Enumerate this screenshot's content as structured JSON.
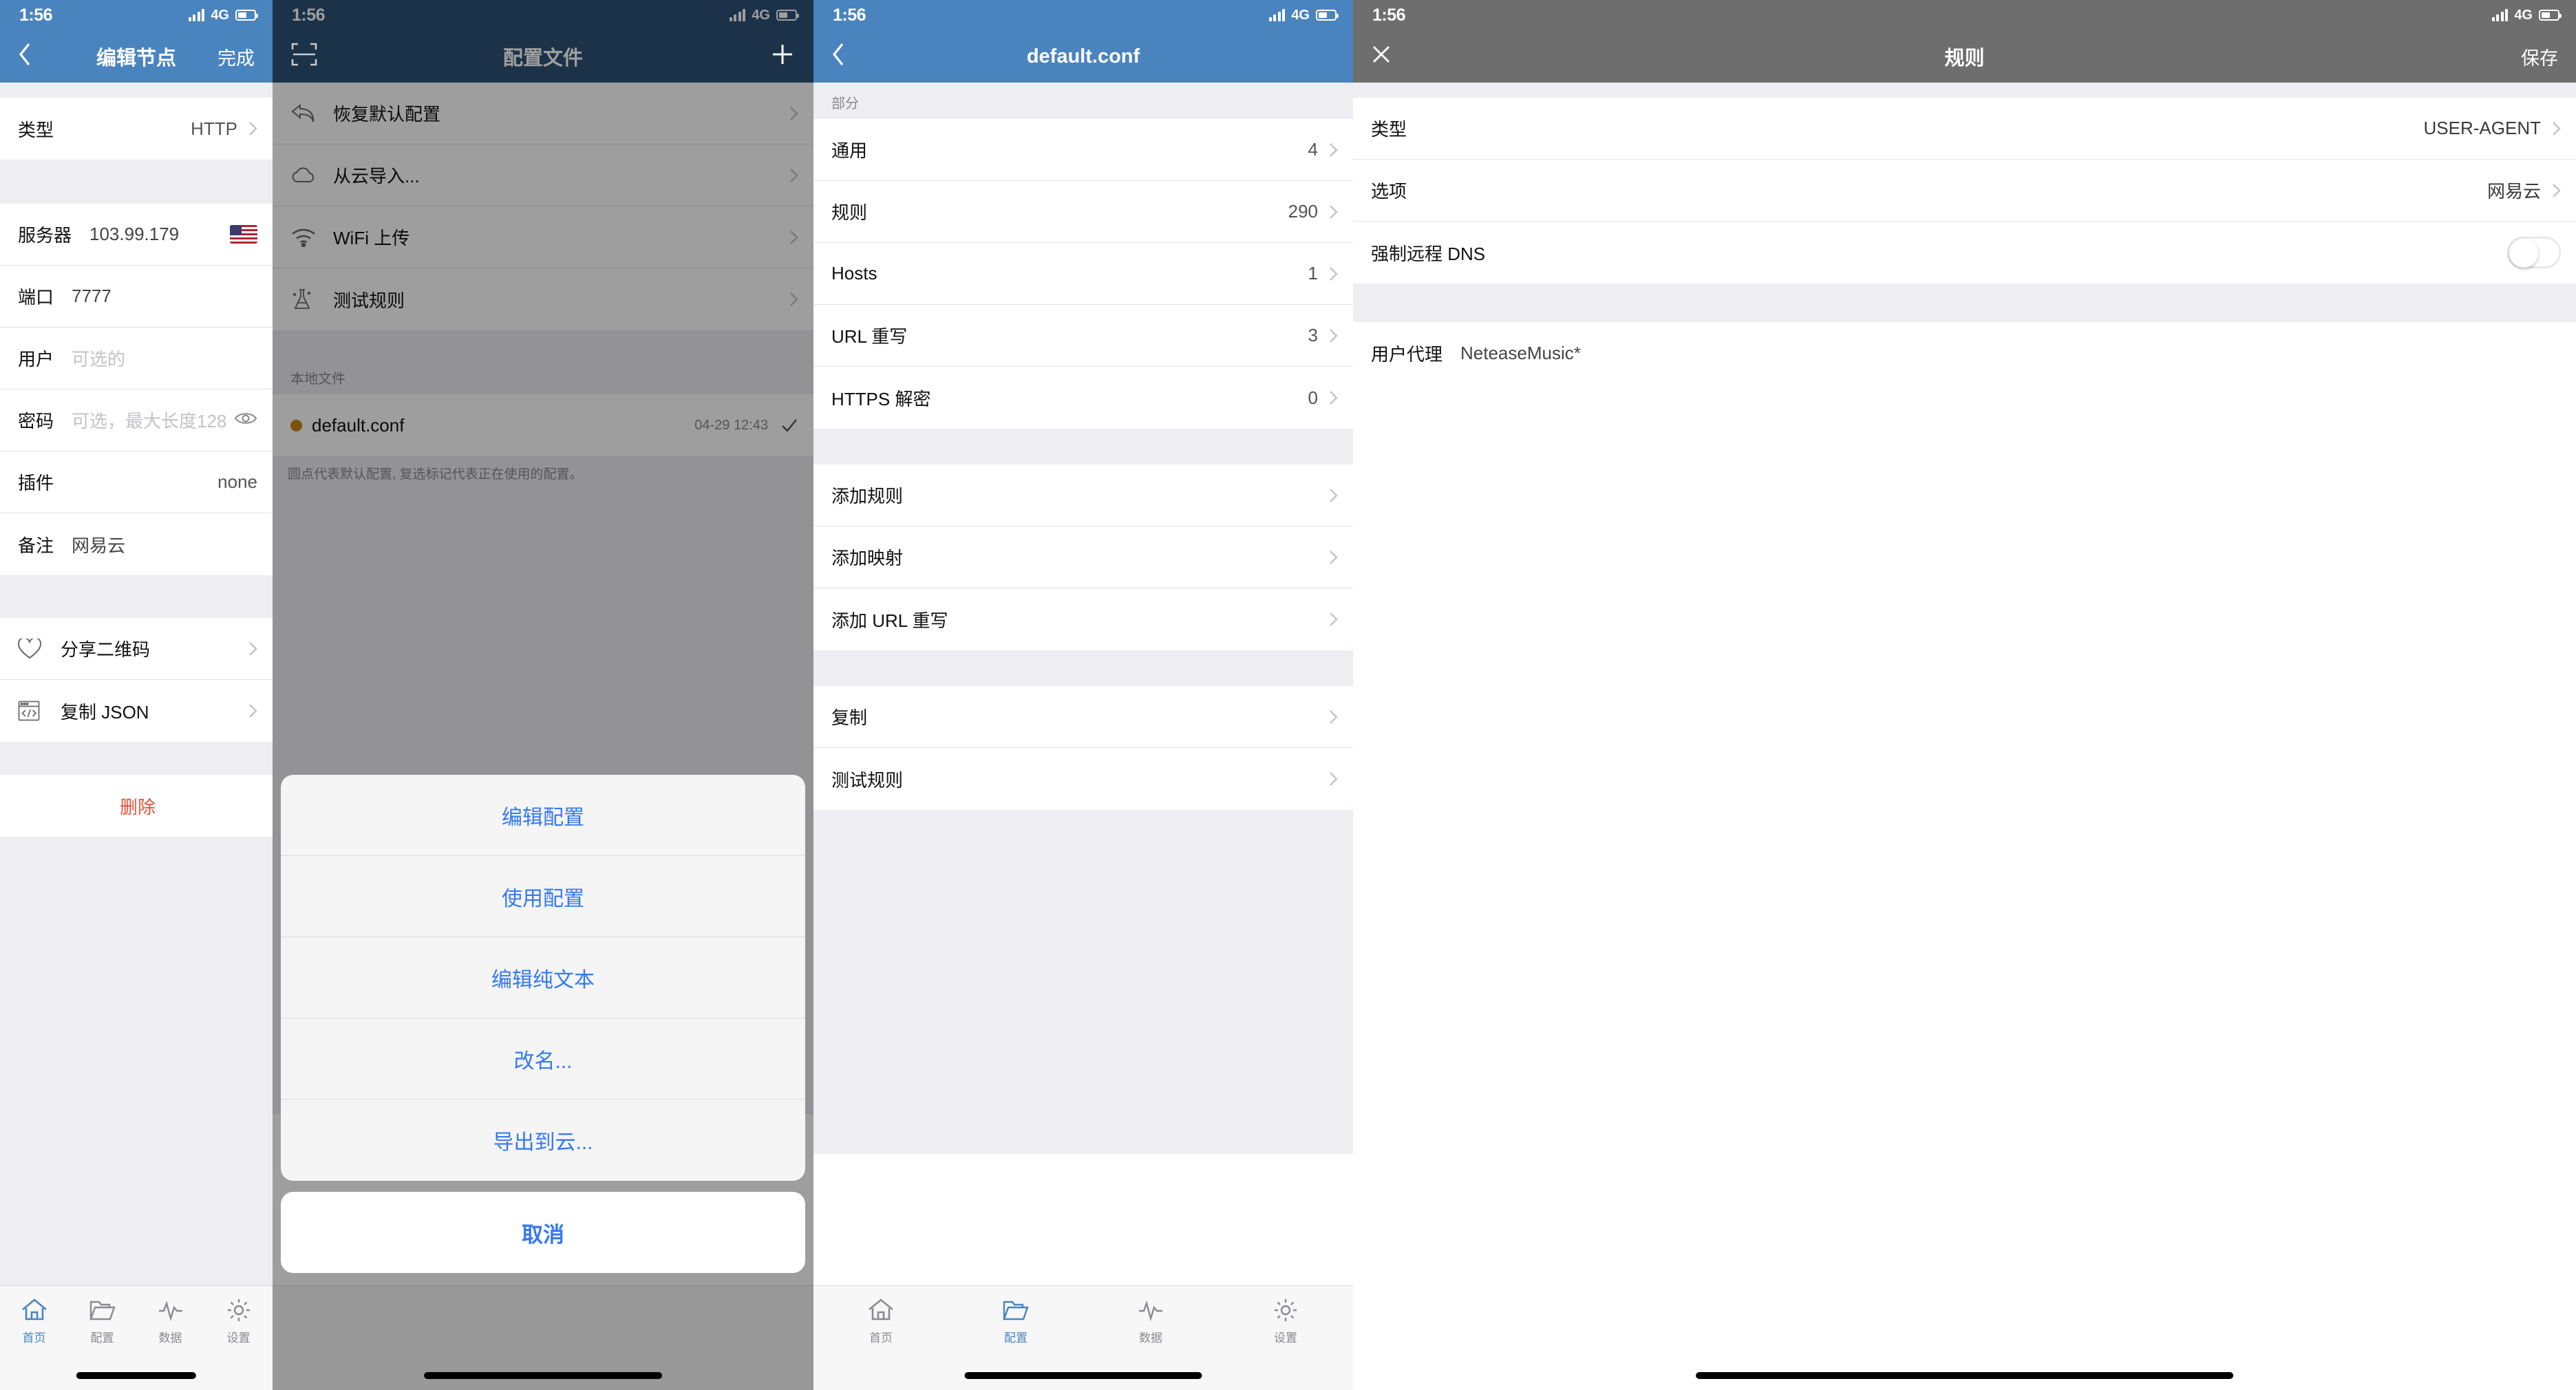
{
  "statusbar": {
    "time": "1:56",
    "network": "4G"
  },
  "colors": {
    "nav_blue": "#4a84bf",
    "nav_navy": "#2e5277",
    "nav_gray": "#6e6e6e",
    "accent_blue": "#3478f6",
    "destructive": "#e8503a",
    "default_dot": "#c8860d"
  },
  "panel1": {
    "nav": {
      "back_icon": "chevron-left-icon",
      "title": "编辑节点",
      "right_label": "完成"
    },
    "rows": [
      {
        "label": "类型",
        "value": "HTTP",
        "chevron": true
      }
    ],
    "server_group": [
      {
        "label": "服务器",
        "value": "103.99.179",
        "flag": "us-flag-icon"
      },
      {
        "label": "端口",
        "value": "7777"
      },
      {
        "label": "用户",
        "value": "可选的",
        "placeholder": true
      },
      {
        "label": "密码",
        "value": "可选，最大长度128",
        "placeholder": true,
        "eye": "eye-icon"
      },
      {
        "label": "插件",
        "value": "none",
        "right_aligned": true
      },
      {
        "label": "备注",
        "value": "网易云"
      }
    ],
    "action_rows": [
      {
        "icon": "heart-icon",
        "label": "分享二维码"
      },
      {
        "icon": "code-window-icon",
        "label": "复制 JSON"
      }
    ],
    "delete_label": "删除",
    "tabs": [
      {
        "icon": "home-icon",
        "label": "首页",
        "active": true
      },
      {
        "icon": "folder-icon",
        "label": "配置",
        "active": false
      },
      {
        "icon": "pulse-icon",
        "label": "数据",
        "active": false
      },
      {
        "icon": "gear-icon",
        "label": "设置",
        "active": false
      }
    ]
  },
  "panel2": {
    "nav": {
      "left_icon": "scan-icon",
      "title": "配置文件",
      "right_icon": "plus-icon"
    },
    "menu": [
      {
        "icon": "undo-arrow-icon",
        "label": "恢复默认配置"
      },
      {
        "icon": "cloud-icon",
        "label": "从云导入..."
      },
      {
        "icon": "wifi-icon",
        "label": "WiFi 上传"
      },
      {
        "icon": "flask-icon",
        "label": "测试规则"
      }
    ],
    "local_section_title": "本地文件",
    "files": [
      {
        "name": "default.conf",
        "timestamp": "04-29 12:43",
        "is_default": true,
        "in_use": true
      }
    ],
    "footnote": "圆点代表默认配置, 复选标记代表正在使用的配置。",
    "action_sheet": {
      "options": [
        "编辑配置",
        "使用配置",
        "编辑纯文本",
        "改名...",
        "导出到云..."
      ],
      "cancel": "取消"
    }
  },
  "panel3": {
    "nav": {
      "back_icon": "chevron-left-icon",
      "title": "default.conf"
    },
    "section_header": "部分",
    "sections": [
      {
        "label": "通用",
        "count": "4"
      },
      {
        "label": "规则",
        "count": "290"
      },
      {
        "label": "Hosts",
        "count": "1"
      },
      {
        "label": "URL 重写",
        "count": "3"
      },
      {
        "label": "HTTPS 解密",
        "count": "0"
      }
    ],
    "add_actions": [
      {
        "label": "添加规则"
      },
      {
        "label": "添加映射"
      },
      {
        "label": "添加 URL 重写"
      }
    ],
    "file_actions": [
      {
        "label": "复制"
      },
      {
        "label": "测试规则"
      }
    ],
    "tabs": [
      {
        "icon": "home-icon",
        "label": "首页",
        "active": false
      },
      {
        "icon": "folder-icon",
        "label": "配置",
        "active": true
      },
      {
        "icon": "pulse-icon",
        "label": "数据",
        "active": false
      },
      {
        "icon": "gear-icon",
        "label": "设置",
        "active": false
      }
    ]
  },
  "panel4": {
    "nav": {
      "close_icon": "close-icon",
      "title": "规则",
      "right_label": "保存"
    },
    "rows": [
      {
        "label": "类型",
        "value": "USER-AGENT",
        "chevron": true
      },
      {
        "label": "选项",
        "value": "网易云",
        "chevron": true
      },
      {
        "label": "强制远程 DNS",
        "toggle": true,
        "toggle_on": false
      }
    ],
    "agent_row": {
      "label": "用户代理",
      "value": "NeteaseMusic*"
    }
  }
}
